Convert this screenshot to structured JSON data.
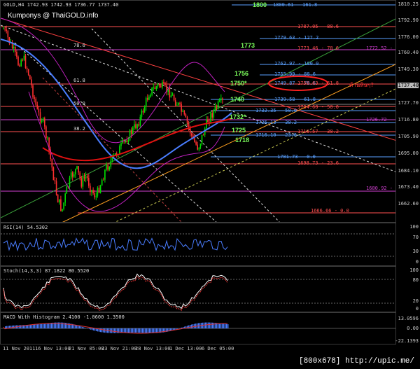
{
  "main": {
    "title": "GOLD,H4  1742.93 1742.93 1736.77 1737.40",
    "watermark": "Kumponys @ ThaiGOLD.info",
    "price_axis": [
      "1810.25",
      "1792.90",
      "1776.00",
      "1760.40",
      "1749.30",
      "1737.40",
      "1727.70",
      "1716.80",
      "1705.90",
      "1695.00",
      "1684.10",
      "1673.40",
      "1662.60"
    ],
    "current_price": "1737.40",
    "fib_left": [
      {
        "text": "1800.61 - 161.8",
        "color": "#5aa0ff"
      },
      {
        "text": "1787.05 - 88.6",
        "color": "#ff5050"
      },
      {
        "text": "1779.63 - 127.2",
        "color": "#5aa0ff"
      },
      {
        "text": "1773.46 - 78.6",
        "color": "#ff5050"
      },
      {
        "text": "1762.97 - 100.0",
        "color": "#5aa0ff"
      },
      {
        "text": "1755.99 - 88.6",
        "color": "#5aa0ff"
      },
      {
        "text": "1749.87 - 78.6",
        "color": "#5aa0ff"
      },
      {
        "text": "1750.63 - 61.8",
        "color": "#ff5050"
      },
      {
        "text": "1739.58 - 61.8",
        "color": "#5aa0ff"
      },
      {
        "text": "1734.60 - 50.0",
        "color": "#ff5050"
      },
      {
        "text": "1732.35 - 50.0",
        "color": "#5aa0ff"
      },
      {
        "text": "1725.13 - 38.2",
        "color": "#5aa0ff"
      },
      {
        "text": "1718.57 - 38.2",
        "color": "#ff5050"
      },
      {
        "text": "1716.10 - 23.6",
        "color": "#5aa0ff"
      },
      {
        "text": "1701.73 - 0.0",
        "color": "#5aa0ff"
      },
      {
        "text": "1698.73 - 23.6",
        "color": "#ff5050"
      },
      {
        "text": "1666.66 - 0.0",
        "color": "#ff5050"
      }
    ],
    "fib_right": [
      {
        "text": "1772.52 - 61.8"
      },
      {
        "text": "1726.72 - 50.0"
      },
      {
        "text": "1680.92 - 38.2"
      }
    ],
    "levels": [
      {
        "text": "1800",
        "color": "#7cff5c"
      },
      {
        "text": "1773",
        "color": "#7cff5c"
      },
      {
        "text": "1756",
        "color": "#7cff5c"
      },
      {
        "text": "1750*",
        "color": "#7cff5c"
      },
      {
        "text": "1740",
        "color": "#7cff5c"
      },
      {
        "text": "1732*",
        "color": "#7cff5c"
      },
      {
        "text": "1725",
        "color": "#7cff5c"
      },
      {
        "text": "1718",
        "color": "#7cff5c"
      }
    ],
    "left_fib_marks": [
      "78.6",
      "61.8",
      "50.0",
      "38.2"
    ],
    "annotation": "ต้านหินๆ?"
  },
  "rsi": {
    "title": "RSI(14) 54.5302",
    "axis": [
      "100",
      "70",
      "30",
      "0"
    ]
  },
  "stoch": {
    "title": "Stoch(14,3,3) 87.1822 80.5520",
    "axis": [
      "100",
      "80",
      "20",
      "0"
    ]
  },
  "macd": {
    "title": "MACD With Histogram 2.4100 -1.0600 1.3500",
    "axis": [
      "13.0596",
      "0.00",
      "-22.1393"
    ]
  },
  "dates": [
    "11 Nov 2011",
    "16 Nov 13:00",
    "21 Nov 05:00",
    "23 Nov 21:00",
    "28 Nov 13:00",
    "1 Dec 13:00",
    "6 Dec 05:00"
  ],
  "footer": "[800x678] http://upic.me/",
  "colors": {
    "bull": "#00e000",
    "bear": "#ff3030",
    "ma_red": "#e01010",
    "ma_blue": "#4a7dff",
    "band": "#c020c0"
  }
}
